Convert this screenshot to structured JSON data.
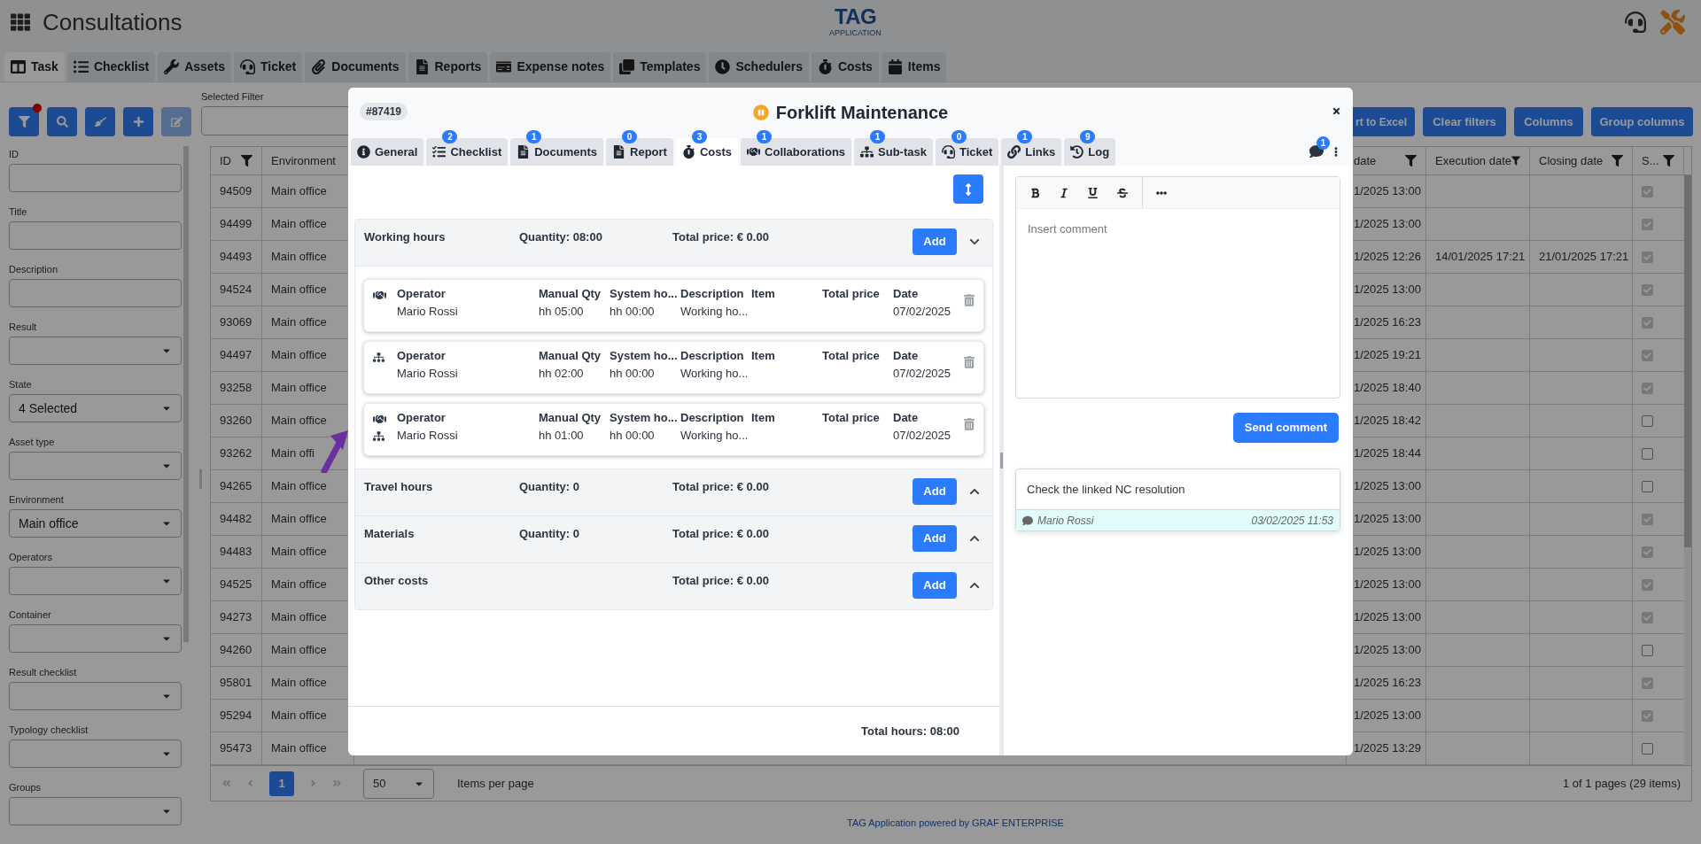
{
  "app": {
    "title": "Consultations",
    "logo_text": "TAG",
    "logo_subtext": "APPLICATION"
  },
  "nav_tabs": [
    {
      "label": "Task",
      "selected": true
    },
    {
      "label": "Checklist",
      "selected": false
    },
    {
      "label": "Assets",
      "selected": false
    },
    {
      "label": "Ticket",
      "selected": false
    },
    {
      "label": "Documents",
      "selected": false
    },
    {
      "label": "Reports",
      "selected": false
    },
    {
      "label": "Expense notes",
      "selected": false
    },
    {
      "label": "Templates",
      "selected": false
    },
    {
      "label": "Schedulers",
      "selected": false
    },
    {
      "label": "Costs",
      "selected": false
    },
    {
      "label": "Items",
      "selected": false
    }
  ],
  "toolbar": {
    "icon_buttons": [
      {
        "kind": "filter",
        "dot": true,
        "disabled": false
      },
      {
        "kind": "search",
        "dot": false,
        "disabled": false
      },
      {
        "kind": "clear",
        "dot": false,
        "disabled": false
      },
      {
        "kind": "add",
        "dot": false,
        "disabled": false
      },
      {
        "kind": "edit",
        "dot": false,
        "disabled": true
      }
    ],
    "selected_filter_label": "Selected Filter",
    "buttons": [
      "rt to Excel",
      "Clear filters",
      "Columns",
      "Group columns"
    ]
  },
  "filters": [
    {
      "label": "ID",
      "kind": "text"
    },
    {
      "label": "Title",
      "kind": "text"
    },
    {
      "label": "Description",
      "kind": "text"
    },
    {
      "label": "Result",
      "kind": "select"
    },
    {
      "label": "State",
      "kind": "select",
      "value": "4 Selected"
    },
    {
      "label": "Asset type",
      "kind": "select"
    },
    {
      "label": "Environment",
      "kind": "select",
      "value": "Main office"
    },
    {
      "label": "Operators",
      "kind": "select"
    },
    {
      "label": "Container",
      "kind": "select"
    },
    {
      "label": "Result checklist",
      "kind": "select"
    },
    {
      "label": "Typology checklist",
      "kind": "select"
    },
    {
      "label": "Groups",
      "kind": "select"
    }
  ],
  "table": {
    "columns": [
      {
        "label": "ID",
        "filter": true
      },
      {
        "label": "Environment",
        "filter": false
      },
      {
        "label": "date",
        "filter": true
      },
      {
        "label": "Execution date",
        "filter": true
      },
      {
        "label": "Closing date",
        "filter": true
      },
      {
        "label": "S...",
        "filter": true
      }
    ],
    "rows": [
      {
        "id": "94509",
        "environment": "Main office",
        "date": "1/2025 13:00",
        "checked": true
      },
      {
        "id": "94499",
        "environment": "Main office",
        "date": "1/2025 13:00",
        "checked": true
      },
      {
        "id": "94493",
        "environment": "Main office",
        "date": "1/2025 12:26",
        "execution_date": "14/01/2025 17:21",
        "closing_date": "21/01/2025 17:21",
        "checked": true
      },
      {
        "id": "94524",
        "environment": "Main office",
        "date": "1/2025 13:00",
        "checked": true
      },
      {
        "id": "93069",
        "environment": "Main office",
        "date": "1/2025 16:23",
        "checked": true
      },
      {
        "id": "94497",
        "environment": "Main office",
        "date": "1/2025 19:21",
        "checked": true
      },
      {
        "id": "93258",
        "environment": "Main office",
        "date": "1/2025 18:40",
        "checked": true
      },
      {
        "id": "93260",
        "environment": "Main office",
        "date": "1/2025 18:42",
        "checked": false
      },
      {
        "id": "93262",
        "environment": "Main offi",
        "date": "1/2025 18:44",
        "checked": false
      },
      {
        "id": "94265",
        "environment": "Main office",
        "date": "1/2025 13:00",
        "checked": false
      },
      {
        "id": "94482",
        "environment": "Main office",
        "date": "1/2025 13:00",
        "checked": true
      },
      {
        "id": "94483",
        "environment": "Main office",
        "date": "1/2025 13:00",
        "checked": true
      },
      {
        "id": "94525",
        "environment": "Main office",
        "date": "1/2025 13:00",
        "checked": true
      },
      {
        "id": "94273",
        "environment": "Main office",
        "date": "1/2025 13:00",
        "checked": true
      },
      {
        "id": "94260",
        "environment": "Main office",
        "date": "1/2025 13:00",
        "checked": false
      },
      {
        "id": "95801",
        "environment": "Main office",
        "date": "1/2025 16:23",
        "checked": true
      },
      {
        "id": "95294",
        "environment": "Main office",
        "date": "1/2025 13:00",
        "checked": true
      },
      {
        "id": "95473",
        "environment": "Main office",
        "date": "1/2025 13:29",
        "checked": false
      }
    ]
  },
  "pagination": {
    "page": "1",
    "page_size": "50",
    "page_size_label": "Items per page",
    "summary": "1 of 1 pages (29 items)"
  },
  "footer": "TAG Application powered by GRAF ENTERPRISE",
  "modal": {
    "id_badge": "#87419",
    "paused": true,
    "title": "Forklift Maintenance",
    "tabs": [
      {
        "label": "General",
        "selected": false
      },
      {
        "label": "Checklist",
        "count": "2",
        "selected": false
      },
      {
        "label": "Documents",
        "count": "1",
        "selected": false
      },
      {
        "label": "Report",
        "count": "0",
        "selected": false
      },
      {
        "label": "Costs",
        "count": "3",
        "selected": true
      },
      {
        "label": "Collaborations",
        "count": "1",
        "selected": false
      },
      {
        "label": "Sub-task",
        "count": "1",
        "selected": false
      },
      {
        "label": "Ticket",
        "count": "0",
        "selected": false
      },
      {
        "label": "Links",
        "count": "1",
        "selected": false
      },
      {
        "label": "Log",
        "count": "9",
        "selected": false
      }
    ],
    "comments_count": "1",
    "cost_sections": [
      {
        "title": "Working hours",
        "quantity": "Quantity: 08:00",
        "total": "Total price: € 0.00",
        "add_label": "Add",
        "expanded": true,
        "entries": [
          {
            "kind": "collaboration",
            "fields": [
              {
                "label": "Operator",
                "value": "Mario Rossi"
              },
              {
                "label": "Manual Qty",
                "value": "hh 05:00"
              },
              {
                "label": "System ho...",
                "value": "hh 00:00"
              },
              {
                "label": "Description",
                "value": "Working ho..."
              },
              {
                "label": "Item"
              },
              {
                "label": "Total price"
              },
              {
                "label": "Date",
                "value": "07/02/2025"
              }
            ]
          },
          {
            "kind": "subtask",
            "fields": [
              {
                "label": "Operator",
                "value": "Mario Rossi"
              },
              {
                "label": "Manual Qty",
                "value": "hh 02:00"
              },
              {
                "label": "System ho...",
                "value": "hh 00:00"
              },
              {
                "label": "Description",
                "value": "Working ho..."
              },
              {
                "label": "Item"
              },
              {
                "label": "Total price"
              },
              {
                "label": "Date",
                "value": "07/02/2025"
              }
            ]
          },
          {
            "kind": "both",
            "fields": [
              {
                "label": "Operator",
                "value": "Mario Rossi"
              },
              {
                "label": "Manual Qty",
                "value": "hh 01:00"
              },
              {
                "label": "System ho...",
                "value": "hh 00:00"
              },
              {
                "label": "Description",
                "value": "Working ho..."
              },
              {
                "label": "Item"
              },
              {
                "label": "Total price"
              },
              {
                "label": "Date",
                "value": "07/02/2025"
              }
            ]
          }
        ]
      },
      {
        "title": "Travel hours",
        "quantity": "Quantity: 0",
        "total": "Total price: € 0.00",
        "add_label": "Add",
        "expanded": false
      },
      {
        "title": "Materials",
        "quantity": "Quantity: 0",
        "total": "Total price: € 0.00",
        "add_label": "Add",
        "expanded": false
      },
      {
        "title": "Other costs",
        "total": "Total price: € 0.00",
        "add_label": "Add",
        "expanded": false
      }
    ],
    "total_hours": "Total hours: 08:00",
    "editor": {
      "placeholder": "Insert comment",
      "send_label": "Send comment"
    },
    "comments": [
      {
        "text": "Check the linked NC resolution",
        "author": "Mario Rossi",
        "time": "03/02/2025 11:53"
      }
    ]
  }
}
